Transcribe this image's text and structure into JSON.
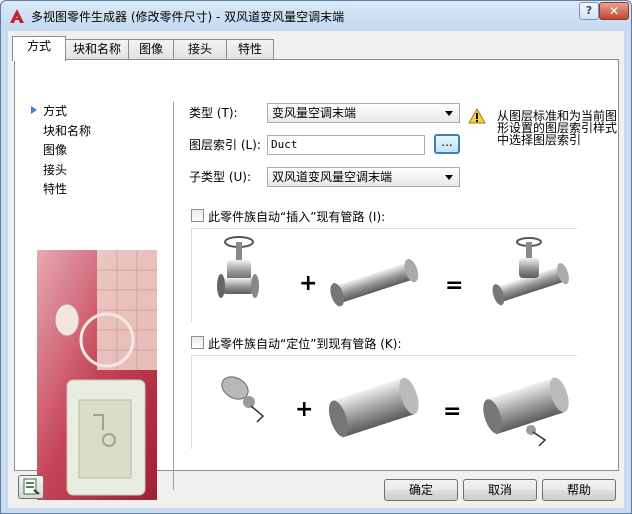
{
  "window": {
    "title": "多视图零件生成器 (修改零件尺寸) - 双风道变风量空调末端",
    "help_glyph": "?",
    "close_glyph": "✕",
    "app_icon": "autocad-logo-icon"
  },
  "tabs": [
    {
      "label": "方式",
      "active": true
    },
    {
      "label": "块和名称",
      "active": false
    },
    {
      "label": "图像",
      "active": false
    },
    {
      "label": "接头",
      "active": false
    },
    {
      "label": "特性",
      "active": false
    }
  ],
  "nav": {
    "items": [
      "方式",
      "块和名称",
      "图像",
      "接头",
      "特性"
    ],
    "selected": "方式"
  },
  "form": {
    "type_label": "类型 (T):",
    "type_value": "变风量空调末端",
    "layer_key_label": "图层索引 (L):",
    "layer_key_value": "Duct",
    "browse_label": "...",
    "subtype_label": "子类型 (U):",
    "subtype_value": "双风道变风量空调末端",
    "warning_text": "从图层标准和为当前图形设置的图层索引样式中选择图层索引"
  },
  "options": {
    "insert_label": "此零件族自动“插入”现有管路 (I):",
    "insert_checked": false,
    "position_label": "此零件族自动“定位”到现有管路 (K):",
    "position_checked": false,
    "plus": "+",
    "equals": "="
  },
  "buttons": {
    "ok": "确定",
    "cancel": "取消",
    "help": "帮助",
    "bottom_icon": "catalog-icon"
  },
  "colors": {
    "title_bg": "#c9dcf0",
    "close_red": "#c6452f",
    "accent_blue": "#3d7fd1",
    "illustration_red": "#b52a40"
  }
}
